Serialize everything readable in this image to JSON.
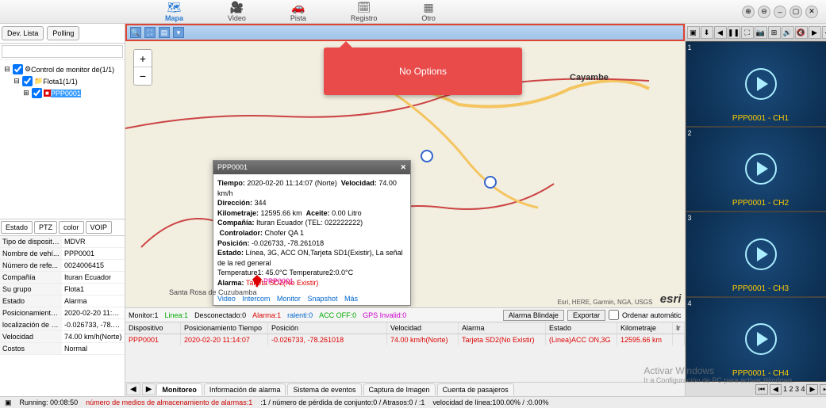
{
  "nav": {
    "mapa": "Mapa",
    "video": "Video",
    "pista": "Pista",
    "registro": "Registro",
    "otro": "Otro"
  },
  "left_tabs": {
    "dev_lista": "Dev. Lista",
    "polling": "Polling"
  },
  "search_placeholder": "",
  "tree": {
    "root": "Control de monitor de(1/1)",
    "fleet": "Flota1(1/1)",
    "vehicle": "PPP0001"
  },
  "mid_tabs": {
    "estado": "Estado",
    "ptz": "PTZ",
    "color": "color",
    "voip": "VOIP"
  },
  "details": [
    {
      "k": "Tipo de dispositivo",
      "v": "MDVR"
    },
    {
      "k": "Nombre de vehí...",
      "v": "PPP0001"
    },
    {
      "k": "Número de refe...",
      "v": "0024006415"
    },
    {
      "k": "Compañía",
      "v": "Ituran Ecuador"
    },
    {
      "k": "Su grupo",
      "v": "Flota1"
    },
    {
      "k": "Estado",
      "v": "Alarma"
    },
    {
      "k": "Posicionamiento...",
      "v": "2020-02-20 11:14:07"
    },
    {
      "k": "localización de v...",
      "v": "-0.026733, -78.261018"
    },
    {
      "k": "Velocidad",
      "v": "74.00 km/h(Norte)"
    },
    {
      "k": "Costos",
      "v": "Normal"
    }
  ],
  "no_options": "No Options",
  "zoom": {
    "plus": "+",
    "minus": "−"
  },
  "popup": {
    "title": "PPP0001",
    "tiempo_k": "Tiempo:",
    "tiempo_v": "2020-02-20 11:14:07 (Norte)",
    "velocidad_k": "Velocidad:",
    "velocidad_v": "74.00 km/h",
    "direccion_k": "Dirección:",
    "direccion_v": "344",
    "kilometraje_k": "Kilometraje:",
    "kilometraje_v": "12595.66 km",
    "aceite_k": "Aceite:",
    "aceite_v": "0.00 Litro",
    "compania_k": "Compañía:",
    "compania_v": "Ituran Ecuador (TEL: 022222222)",
    "controlador_k": "Controlador:",
    "controlador_v": "Chofer QA 1",
    "posicion_k": "Posición:",
    "posicion_v": "-0.026733, -78.261018",
    "estado_k": "Estado:",
    "estado_v": "Línea, 3G, ACC ON,Tarjeta SD1(Existir), La señal de la red general",
    "temp_line": "Temperature1: 45.0°C   Temperature2:0.0°C",
    "alarma_k": "Alarma:",
    "alarma_v": "Tarjeta SD2(No Existir)",
    "links": {
      "video": "Video",
      "intercom": "Intercom",
      "monitor": "Monitor",
      "snapshot": "Snapshot",
      "mas": "Más"
    }
  },
  "marker_label": "PPP0001",
  "town1": "Santa Rosa de Cuzubamba",
  "city1": "Cayambe",
  "attrib": "Esri, HERE, Garmin, NGA, USGS",
  "esri": "esri",
  "monitor_bar": {
    "monitor": "Monitor:1",
    "linea": "Linea:1",
    "desc": "Desconectado:0",
    "alarma": "Alarma:1",
    "ralenti": "ralenti:0",
    "accoff": "ACC OFF:0",
    "gps": "GPS Invalid:0",
    "btn1": "Alarma Blindaje",
    "btn2": "Exportar",
    "chk": "Ordenar automátic"
  },
  "grid": {
    "headers": [
      "Dispositivo",
      "Posicionamiento Tiempo",
      "Posición",
      "Velocidad",
      "Alarma",
      "Estado",
      "Kilometraje",
      "Ir"
    ],
    "row": [
      "PPP0001",
      "2020-02-20 11:14:07",
      "-0.026733, -78.261018",
      "74.00 km/h(Norte)",
      "Tarjeta SD2(No Existir)",
      "(Linea)ACC ON,3G",
      "12595.66 km",
      ""
    ]
  },
  "bottom_tabs": [
    "Monitoreo",
    "Información de alarma",
    "Sistema de eventos",
    "Captura de Imagen",
    "Cuenta de pasajeros"
  ],
  "videos": [
    "PPP0001 - CH1",
    "PPP0001 - CH2",
    "PPP0001 - CH3",
    "PPP0001 - CH4"
  ],
  "video_pager": "1  2  3  4",
  "watermark": {
    "t": "Activar Windows",
    "s": "Ir a Configuración de PC para activar Windows."
  },
  "status": {
    "running": "Running: 00:08:50",
    "alm": "número de medios de almacenamiento de alarmas:1",
    "perdida": ":1 / número de pérdida de conjunto:0 / Atrasos:0 / :1",
    "velocidad": "velocidad de línea:100.00% / :0.00%"
  }
}
